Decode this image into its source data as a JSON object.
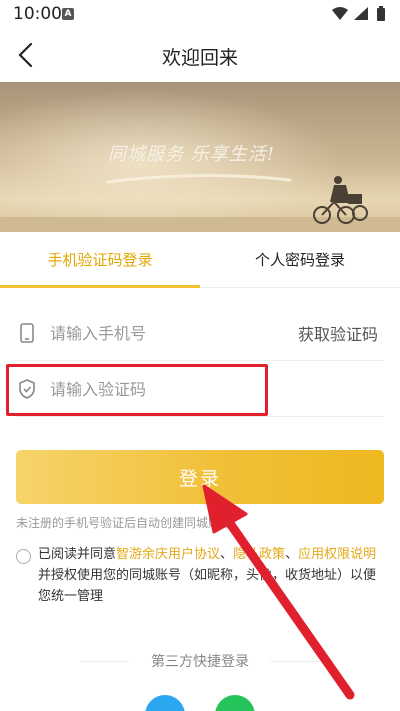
{
  "status_bar": {
    "time": "10:00",
    "notification_badge": "A"
  },
  "header": {
    "title": "欢迎回来"
  },
  "banner": {
    "slogan": "同城服务 乐享生活!"
  },
  "tabs": [
    {
      "label": "手机验证码登录",
      "active": true
    },
    {
      "label": "个人密码登录",
      "active": false
    }
  ],
  "form": {
    "phone_placeholder": "请输入手机号",
    "get_code_label": "获取验证码",
    "code_placeholder": "请输入验证码",
    "login_label": "登录",
    "hint": "未注册的手机号验证后自动创建同城账号"
  },
  "agreement": {
    "prefix": "已阅读并同意",
    "link1": "智游余庆用户协议",
    "sep1": "、",
    "link2": "隐私政策",
    "sep2": "、",
    "link3": "应用权限说明",
    "suffix": "并授权使用您的同城账号（如昵称，头像，收货地址）以便您统一管理"
  },
  "third_party": {
    "title": "第三方快捷登录"
  },
  "colors": {
    "accent": "#f2c230",
    "link": "#e6a817",
    "annotation": "#e0202c"
  },
  "icons": [
    "signal-icon",
    "wifi-icon",
    "battery-icon",
    "back-icon",
    "phone-icon",
    "shield-icon",
    "qq-icon",
    "wechat-icon"
  ]
}
